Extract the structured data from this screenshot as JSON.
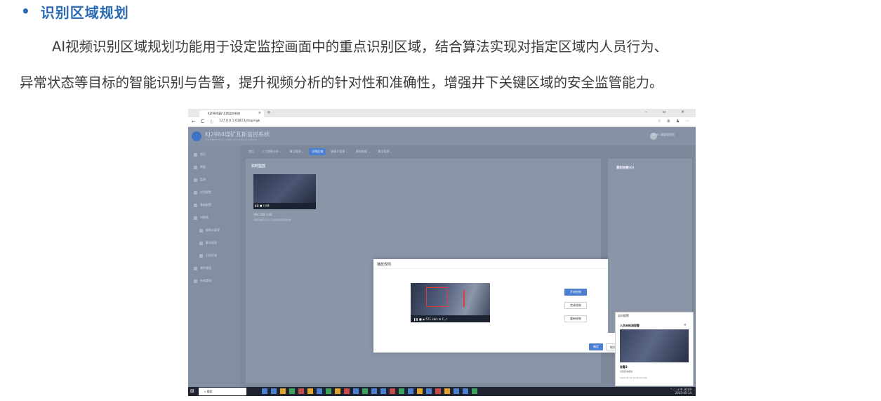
{
  "heading": {
    "bullet": "•",
    "text": "识别区域规划"
  },
  "paragraph": {
    "line1": "AI视频识别区域规划功能用于设定监控画面中的重点识别区域，结合算法实现对指定区域内人员行为、",
    "line2": "异常状态等目标的智能识别与告警，提升视频分析的针对性和准确性，增强井下关键区域的安全监管能力。"
  },
  "screenshot": {
    "browser": {
      "tab_title": "KJ2984煤矿瓦斯监控系统",
      "tab_close": "×",
      "new_tab": "+",
      "window_buttons": "– ▫ ×",
      "url": "127.0.0.1:62813/stop/ngk",
      "nav": {
        "back": "←",
        "reload": "C",
        "info": "ⓘ"
      },
      "addr_icons": "☆ ⊕ ♟ ⋯"
    },
    "app": {
      "title": "KJ2984煤矿瓦斯监控系统",
      "subtitle": "Intelligent mine video surveillance system",
      "user": "admin 超级管理员",
      "sidebar": [
        "首页",
        "数据",
        "监测",
        "应用配置",
        "基础配置",
        "AI视频",
        "摄像头管理",
        "算法管理",
        "识别区域",
        "事件管理",
        "系统管理"
      ],
      "top_nav": [
        "首页",
        "人工智能分析 ⌄",
        "算法管理 ⌄",
        "识别区域",
        "摄像头管理 ⌄",
        "基础数据 ⌄",
        "算法管理 ⌄"
      ],
      "active_nav_index": 3,
      "content_title": "实时监控",
      "thumb_label": "192.168.1.41",
      "thumb_desc": "识别区域有人员上下设置请检查识别状态",
      "thumb_bar": "❚❚ ■ 1分钟",
      "right_panel_title": "最新报警(0)",
      "popup": {
        "header": "实时报警",
        "card_title": "人员未检测报警",
        "close": "×",
        "t1": "告警2",
        "t2": "识别区域报警",
        "t3": "2025-05-14 16:49:04.395"
      }
    },
    "modal": {
      "title": "播放规则",
      "close": "×",
      "video_bar": "❚❚  ■   ◈ 571 kb/s    ⚙   C   ⤢",
      "buttons": [
        "开始绘制",
        "完成绘制",
        "重新绘制"
      ],
      "ok": "确定",
      "cancel": "取消"
    },
    "taskbar": {
      "start": "⊞",
      "search": "⌕ 搜索",
      "time": "16:49",
      "date": "2025-05-14",
      "tray": "⌃ ◌ ◁ 中"
    }
  }
}
